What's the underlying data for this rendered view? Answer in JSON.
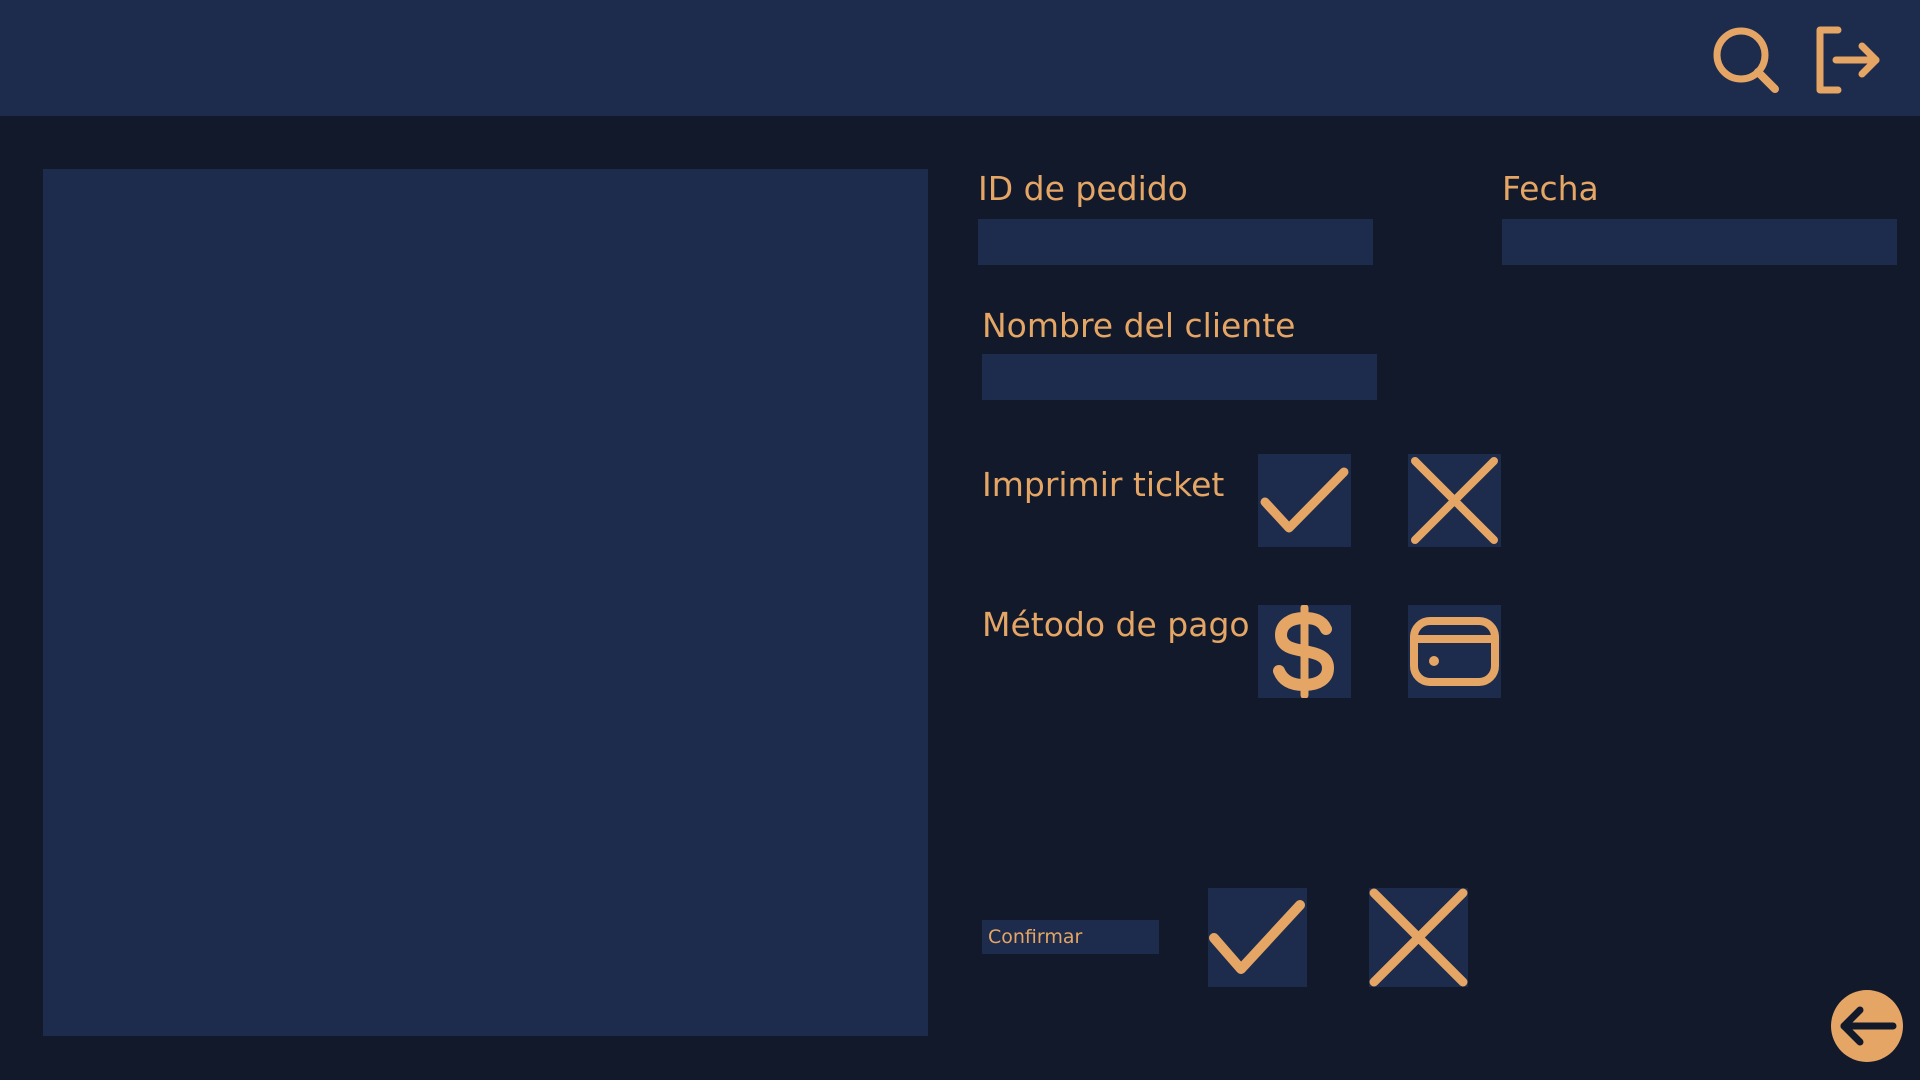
{
  "theme": {
    "background": "#11192b",
    "surface": "#1d2b4d",
    "accent": "#e5a665"
  },
  "header": {
    "actions": [
      {
        "icon": "search-icon"
      },
      {
        "icon": "logout-icon"
      }
    ]
  },
  "form": {
    "order_id": {
      "label": "ID de pedido",
      "value": ""
    },
    "date": {
      "label": "Fecha",
      "value": ""
    },
    "customer_name": {
      "label": "Nombre del cliente",
      "value": ""
    },
    "print_ticket": {
      "label": "Imprimir ticket",
      "options": [
        {
          "icon": "check-icon"
        },
        {
          "icon": "close-icon"
        }
      ]
    },
    "payment_method": {
      "label": "Método de pago",
      "options": [
        {
          "icon": "dollar-icon"
        },
        {
          "icon": "credit-card-icon"
        }
      ]
    },
    "confirm": {
      "label": "Confirmar",
      "options": [
        {
          "icon": "check-icon"
        },
        {
          "icon": "close-icon"
        }
      ]
    }
  },
  "footer": {
    "back": {
      "icon": "arrow-left-icon"
    }
  }
}
